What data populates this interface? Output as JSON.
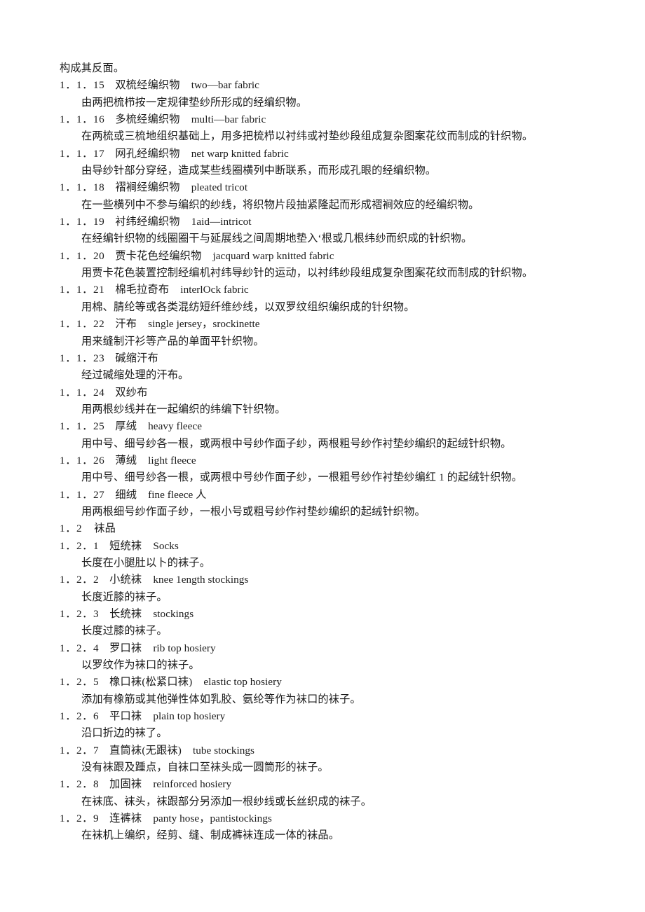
{
  "page": {
    "continued_text": "构成其反面。",
    "text_color": "#1a1a1a",
    "background_color": "#ffffff"
  },
  "sections": [
    {
      "type": "entry",
      "number": "1．1．15",
      "term_cn": "双梳经编织物",
      "term_en": "two—bar fabric",
      "definition": "由两把梳栉按一定规律垫纱所形成的经编织物。"
    },
    {
      "type": "entry",
      "number": "1．1．16",
      "term_cn": "多梳经编织物",
      "term_en": "multi—bar fabric",
      "definition": "在两梳或三梳地组织基础上，用多把梳栉以衬纬或衬垫纱段组成复杂图案花纹而制成的针织物。"
    },
    {
      "type": "entry",
      "number": "1．1．17",
      "term_cn": "网孔经编织物",
      "term_en": "net warp knitted fabric",
      "definition": "由导纱针部分穿经，造成某些线圈横列中断联系，而形成孔眼的经编织物。"
    },
    {
      "type": "entry",
      "number": "1．1．18",
      "term_cn": "褶裥经编织物",
      "term_en": "pleated tricot",
      "definition": "在一些横列中不参与编织的纱线，将织物片段抽紧隆起而形成褶裥效应的经编织物。"
    },
    {
      "type": "entry",
      "number": "1．1．19",
      "term_cn": "衬纬经编织物",
      "term_en": "1aid—intricot",
      "definition": "在经编针织物的线圈圈干与延展线之间周期地垫入‘根或几根纬纱而织成的针织物。"
    },
    {
      "type": "entry",
      "number": "1．1．20",
      "term_cn": "贾卡花色经编织物",
      "term_en": "jacquard warp knitted fabric",
      "definition": "用贾卡花色装置控制经编机衬纬导纱针的运动，以衬纬纱段组成复杂图案花纹而制成的针织物。"
    },
    {
      "type": "entry",
      "number": "1．1．21",
      "term_cn": "棉毛拉奇布",
      "term_en": "interlOck fabric",
      "definition": "用棉、腈纶等或各类混纺短纤维纱线，以双罗纹组织编织成的针织物。"
    },
    {
      "type": "entry",
      "number": "1．1．22",
      "term_cn": "汗布",
      "term_en": "single jersey，srockinette",
      "definition": "用来缝制汗衫等产品的单面平针织物。"
    },
    {
      "type": "entry",
      "number": "1．1．23",
      "term_cn": "碱缩汗布",
      "term_en": "",
      "definition": "经过碱缩处理的汗布。"
    },
    {
      "type": "entry",
      "number": "1．1．24",
      "term_cn": "双纱布",
      "term_en": "",
      "definition": "用两根纱线并在一起编织的纬编下针织物。"
    },
    {
      "type": "entry",
      "number": "1．1．25",
      "term_cn": "厚绒",
      "term_en": "heavy fleece",
      "definition": "用中号、细号纱各一根，或两根中号纱作面子纱，两根粗号纱作衬垫纱编织的起绒针织物。"
    },
    {
      "type": "entry",
      "number": "1．1．26",
      "term_cn": "薄绒",
      "term_en": "light fleece",
      "definition": "用中号、细号纱各一根，或两根中号纱作面子纱，一根粗号纱作衬垫纱编红 1 的起绒针织物。"
    },
    {
      "type": "entry",
      "number": "1．1．27",
      "term_cn": "细绒",
      "term_en": "fine fleece 人",
      "definition": "用两根细号纱作面子纱，一根小号或粗号纱作衬垫纱编织的起绒针织物。"
    },
    {
      "type": "section",
      "number": "1．2",
      "term_cn": "袜品",
      "term_en": "",
      "definition": ""
    },
    {
      "type": "entry",
      "number": "1．2．1",
      "term_cn": "短统袜",
      "term_en": "Socks",
      "definition": "长度在小腿肚以卜的袜子。"
    },
    {
      "type": "entry",
      "number": "1．2．2",
      "term_cn": "小统袜",
      "term_en": "knee 1ength stockings",
      "definition": "长度近膝的袜子。"
    },
    {
      "type": "entry",
      "number": "1．2．3",
      "term_cn": "长统袜",
      "term_en": "stockings",
      "definition": "长度过膝的袜子。"
    },
    {
      "type": "entry",
      "number": "1．2．4",
      "term_cn": "罗口袜",
      "term_en": "rib top hosiery",
      "definition": "以罗纹作为袜口的袜子。"
    },
    {
      "type": "entry",
      "number": "1．2．5",
      "term_cn": "橡口袜(松紧口袜)",
      "term_en": "elastic top hosiery",
      "definition": "添加有橡筋或其他弹性体如乳胶、氨纶等作为袜口的袜子。"
    },
    {
      "type": "entry",
      "number": "1．2．6",
      "term_cn": "平口袜",
      "term_en": "plain top hosiery",
      "definition": "沿口折边的袜了。"
    },
    {
      "type": "entry",
      "number": "1．2．7",
      "term_cn": "直筒袜(无跟袜)",
      "term_en": "tube stockings",
      "definition": "没有袜跟及踵点，自袜口至袜头成一圆筒形的袜子。"
    },
    {
      "type": "entry",
      "number": "1．2．8",
      "term_cn": "加固袜",
      "term_en": "reinforced hosiery",
      "definition": "在袜底、袜头，袜跟部分另添加一根纱线或长丝织成的袜子。"
    },
    {
      "type": "entry",
      "number": "1．2．9",
      "term_cn": "连裤袜",
      "term_en": "panty hose，pantistockings",
      "definition": "在袜机上编织，经剪、缝、制成裤袜连成一体的袜品。"
    }
  ]
}
